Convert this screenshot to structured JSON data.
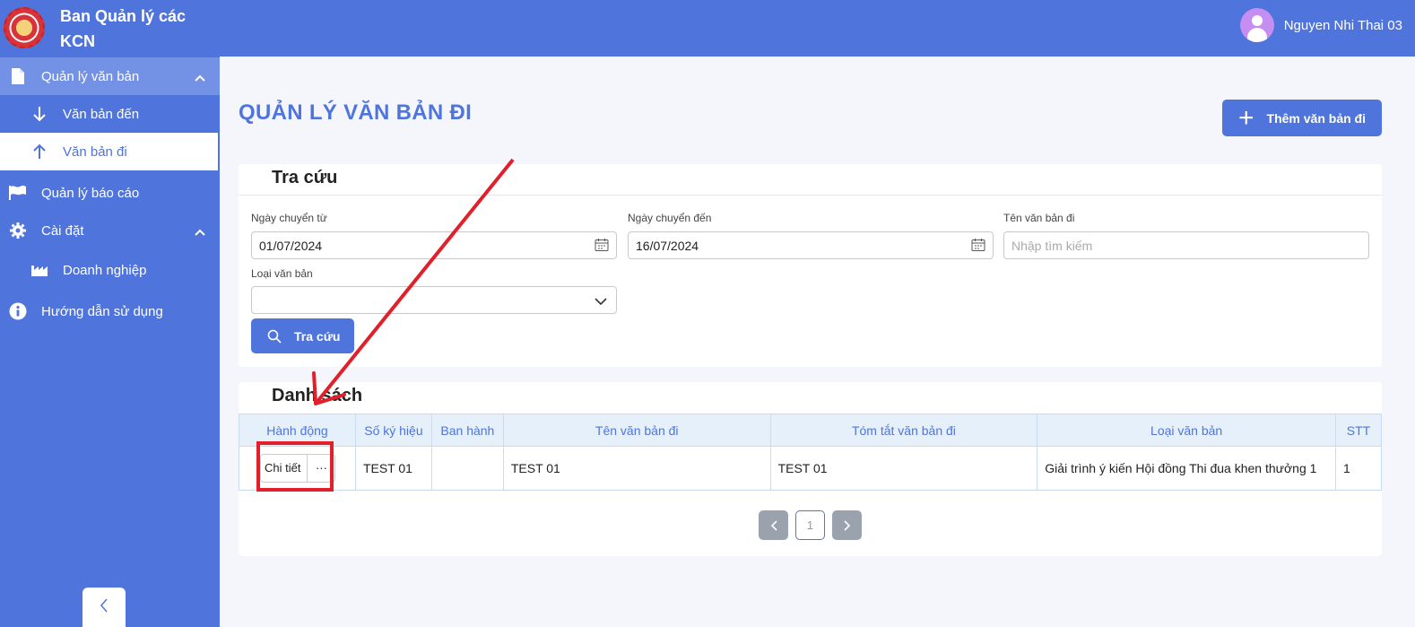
{
  "app": {
    "name": "Ban Quản lý các KCN",
    "name_line1": "Ban Quản lý các",
    "name_line2": "KCN"
  },
  "user": {
    "name": "Nguyen Nhi Thai 03"
  },
  "sidebar": {
    "items": [
      {
        "label": "Quản lý văn bản",
        "icon": "document-icon",
        "expanded": true
      },
      {
        "label": "Văn bản đến",
        "icon": "arrow-down-icon"
      },
      {
        "label": "Văn bản đi",
        "icon": "arrow-up-icon",
        "active": true
      },
      {
        "label": "Quản lý báo cáo",
        "icon": "flag-icon"
      },
      {
        "label": "Cài đặt",
        "icon": "gear-icon",
        "expanded": true
      },
      {
        "label": "Doanh nghiệp",
        "icon": "factory-icon"
      },
      {
        "label": "Hướng dẫn sử dụng",
        "icon": "info-icon"
      }
    ]
  },
  "page": {
    "title": "QUẢN LÝ VĂN BẢN ĐI",
    "add_button": "Thêm văn bản đi"
  },
  "search": {
    "title": "Tra cứu",
    "date_from_label": "Ngày chuyển từ",
    "date_from_value": "01/07/2024",
    "date_to_label": "Ngày chuyển đến",
    "date_to_value": "16/07/2024",
    "name_label": "Tên văn bản đi",
    "name_placeholder": "Nhập tìm kiếm",
    "type_label": "Loại văn bản",
    "type_value": "",
    "button": "Tra cứu"
  },
  "list": {
    "title": "Danh sách",
    "columns": [
      "Hành động",
      "Số ký hiệu",
      "Ban hành",
      "Tên văn bản đi",
      "Tóm tắt văn bản đi",
      "Loại văn bản",
      "STT"
    ],
    "rows": [
      {
        "action_detail": "Chi tiết",
        "action_more": "···",
        "code": "TEST 01",
        "issued": "",
        "name": "TEST 01",
        "summary": "TEST 01",
        "type": "Giải trình ý kiến Hội đồng Thi đua khen thưởng 1",
        "stt": "1"
      }
    ],
    "pagination": {
      "current": "1"
    }
  },
  "colors": {
    "primary": "#4f74dc",
    "annotation": "#e0202a"
  }
}
